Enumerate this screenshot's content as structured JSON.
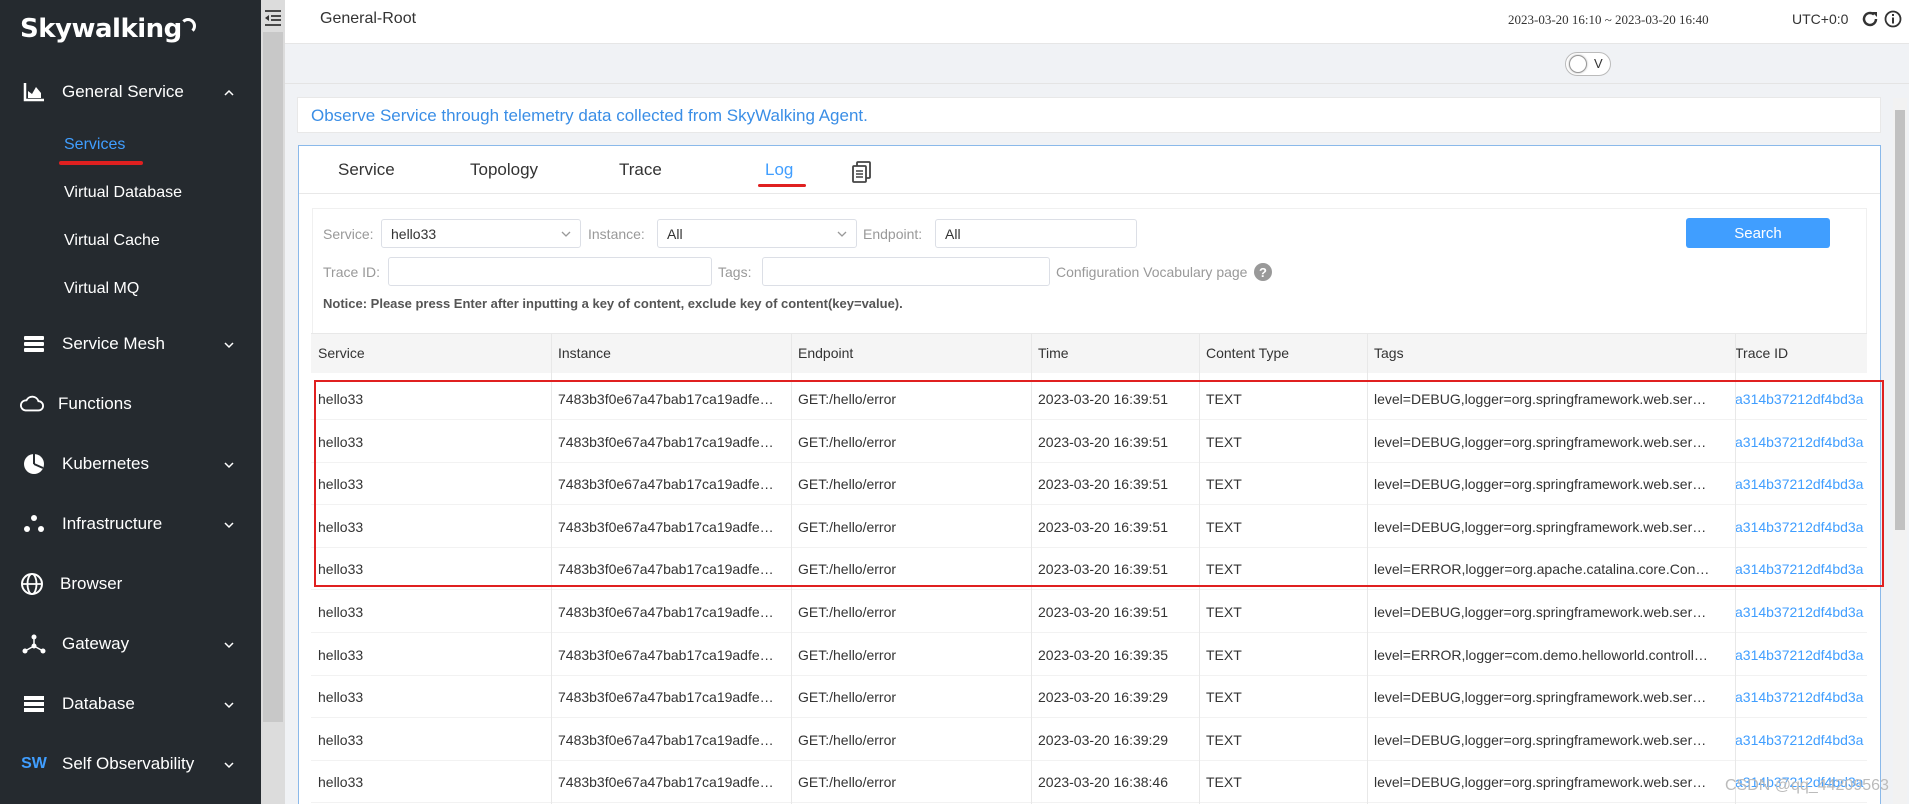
{
  "app": {
    "logo": "Skywalking"
  },
  "sidebar": {
    "items": [
      {
        "label": "General Service",
        "icon": "chart-area-icon",
        "chevron": "up"
      },
      {
        "label": "Service Mesh",
        "icon": "layers-icon",
        "chevron": "down"
      },
      {
        "label": "Functions",
        "icon": "cloud-icon",
        "chevron": ""
      },
      {
        "label": "Kubernetes",
        "icon": "pie-chart-icon",
        "chevron": "down"
      },
      {
        "label": "Infrastructure",
        "icon": "nodes-icon",
        "chevron": "down"
      },
      {
        "label": "Browser",
        "icon": "globe-icon",
        "chevron": ""
      },
      {
        "label": "Gateway",
        "icon": "gateway-icon",
        "chevron": "down"
      },
      {
        "label": "Database",
        "icon": "database-icon",
        "chevron": "down"
      },
      {
        "label": "Self Observability",
        "icon": "sw-logo-icon",
        "chevron": "down"
      }
    ],
    "submenu": [
      {
        "label": "Services",
        "active": true
      },
      {
        "label": "Virtual Database"
      },
      {
        "label": "Virtual Cache"
      },
      {
        "label": "Virtual MQ"
      }
    ]
  },
  "header": {
    "title": "General-Root",
    "time_range": "2023-03-20 16:10 ~ 2023-03-20 16:40",
    "timezone": "UTC+0:0"
  },
  "toggle": {
    "label": "V"
  },
  "notice_bar": "Observe Service through telemetry data collected from SkyWalking Agent.",
  "tabs": [
    {
      "label": "Service"
    },
    {
      "label": "Topology"
    },
    {
      "label": "Trace"
    },
    {
      "label": "Log",
      "active": true
    }
  ],
  "filters": {
    "service_label": "Service:",
    "service_value": "hello33",
    "instance_label": "Instance:",
    "instance_value": "All",
    "endpoint_label": "Endpoint:",
    "endpoint_value": "All",
    "search_label": "Search",
    "traceid_label": "Trace ID:",
    "tags_label": "Tags:",
    "vocab_link": "Configuration Vocabulary page",
    "notice": "Notice: Please press Enter after inputting a key of content, exclude key of content(key=value)."
  },
  "table": {
    "columns": [
      "Service",
      "Instance",
      "Endpoint",
      "Time",
      "Content Type",
      "Tags",
      "Trace ID"
    ],
    "rows": [
      [
        "hello33",
        "7483b3f0e67a47bab17ca19adfe…",
        "GET:/hello/error",
        "2023-03-20 16:39:51",
        "TEXT",
        "level=DEBUG,logger=org.springframework.web.ser…",
        "a314b37212df4bd3a"
      ],
      [
        "hello33",
        "7483b3f0e67a47bab17ca19adfe…",
        "GET:/hello/error",
        "2023-03-20 16:39:51",
        "TEXT",
        "level=DEBUG,logger=org.springframework.web.ser…",
        "a314b37212df4bd3a"
      ],
      [
        "hello33",
        "7483b3f0e67a47bab17ca19adfe…",
        "GET:/hello/error",
        "2023-03-20 16:39:51",
        "TEXT",
        "level=DEBUG,logger=org.springframework.web.ser…",
        "a314b37212df4bd3a"
      ],
      [
        "hello33",
        "7483b3f0e67a47bab17ca19adfe…",
        "GET:/hello/error",
        "2023-03-20 16:39:51",
        "TEXT",
        "level=DEBUG,logger=org.springframework.web.ser…",
        "a314b37212df4bd3a"
      ],
      [
        "hello33",
        "7483b3f0e67a47bab17ca19adfe…",
        "GET:/hello/error",
        "2023-03-20 16:39:51",
        "TEXT",
        "level=ERROR,logger=org.apache.catalina.core.Con…",
        "a314b37212df4bd3a"
      ],
      [
        "hello33",
        "7483b3f0e67a47bab17ca19adfe…",
        "GET:/hello/error",
        "2023-03-20 16:39:51",
        "TEXT",
        "level=DEBUG,logger=org.springframework.web.ser…",
        "a314b37212df4bd3a"
      ],
      [
        "hello33",
        "7483b3f0e67a47bab17ca19adfe…",
        "GET:/hello/error",
        "2023-03-20 16:39:35",
        "TEXT",
        "level=ERROR,logger=com.demo.helloworld.controll…",
        "a314b37212df4bd3a"
      ],
      [
        "hello33",
        "7483b3f0e67a47bab17ca19adfe…",
        "GET:/hello/error",
        "2023-03-20 16:39:29",
        "TEXT",
        "level=DEBUG,logger=org.springframework.web.ser…",
        "a314b37212df4bd3a"
      ],
      [
        "hello33",
        "7483b3f0e67a47bab17ca19adfe…",
        "GET:/hello/error",
        "2023-03-20 16:39:29",
        "TEXT",
        "level=DEBUG,logger=org.springframework.web.ser…",
        "a314b37212df4bd3a"
      ],
      [
        "hello33",
        "7483b3f0e67a47bab17ca19adfe…",
        "GET:/hello/error",
        "2023-03-20 16:38:46",
        "TEXT",
        "level=DEBUG,logger=org.springframework.web.ser…",
        "a314b37212df4bd3a"
      ]
    ]
  },
  "watermark": "CSDN @qq_44209563",
  "colors": {
    "accent": "#409eff",
    "sidebar_bg": "#252a2f",
    "highlight": "#e02020"
  }
}
